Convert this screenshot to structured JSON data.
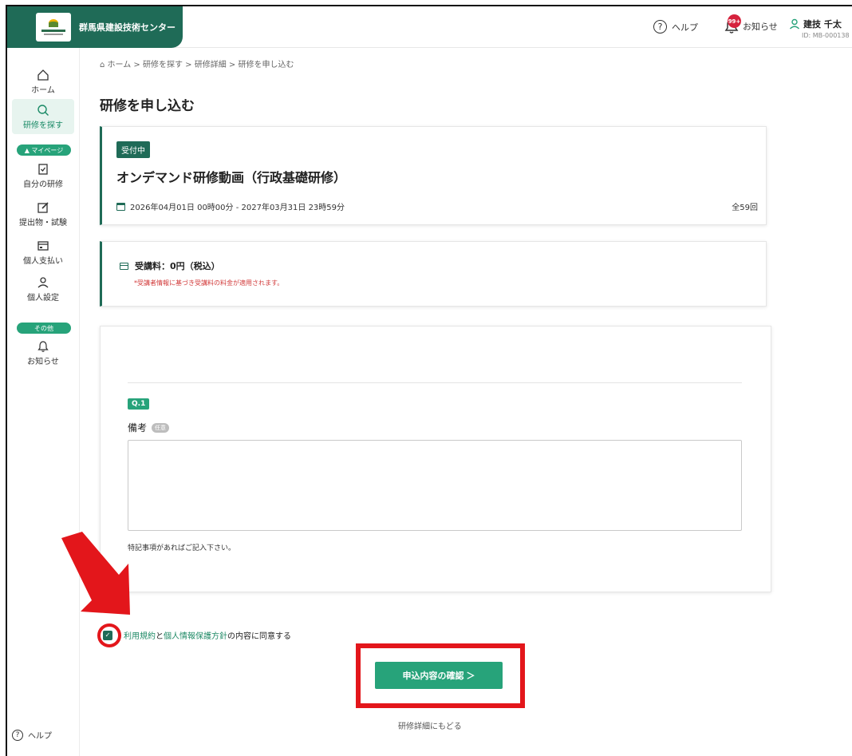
{
  "header": {
    "org_name": "群馬県建設技術センター",
    "help_label": "ヘルプ",
    "notice_badge": "99+",
    "notice_label": "お知らせ",
    "user_name": "建技 千太",
    "user_id": "ID: MB-000138"
  },
  "sidebar": {
    "home": "ホーム",
    "search": "研修を探す",
    "mypage_pill": "▲ マイページ",
    "my_training": "自分の研修",
    "submissions": "提出物・試験",
    "payment": "個人支払い",
    "settings": "個人設定",
    "other_pill": "その他",
    "notices": "お知らせ",
    "help": "ヘルプ"
  },
  "breadcrumb": "ホーム > 研修を探す > 研修詳細 > 研修を申し込む",
  "page_title": "研修を申し込む",
  "course": {
    "status": "受付中",
    "title": "オンデマンド研修動画（行政基礎研修）",
    "period": "2026年04月01日 00時00分 - 2027年03月31日 23時59分",
    "count": "全59回"
  },
  "fee": {
    "label": "受講料：0円（税込）",
    "note": "*受講者情報に基づき受講料の料金が適用されます。"
  },
  "form": {
    "q_badge": "Q.1",
    "q_label": "備考",
    "optional": "任意",
    "help_text": "特記事項があればご記入下さい。"
  },
  "agreement": {
    "terms": "利用規約",
    "and": "と",
    "privacy": "個人情報保護方針",
    "suffix": "の内容に同意する"
  },
  "actions": {
    "confirm": "申込内容の確認 ＞",
    "back": "研修詳細にもどる"
  },
  "colors": {
    "brand": "#1f6b57",
    "accent": "#27a37a",
    "annotation": "#e3161b"
  }
}
